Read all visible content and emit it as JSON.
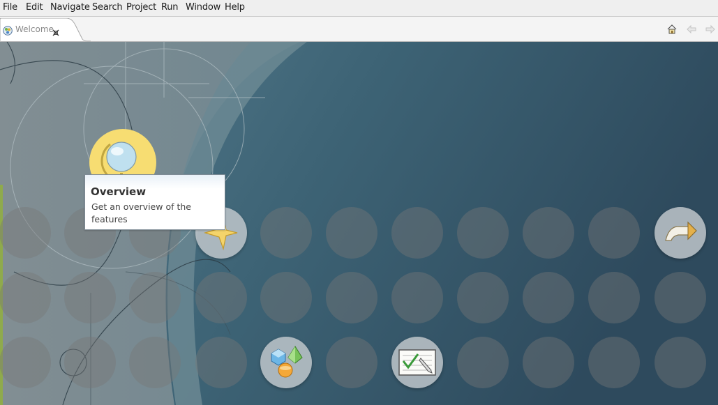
{
  "menu": {
    "items": [
      {
        "label": "File"
      },
      {
        "label": "Edit"
      },
      {
        "label": "Navigate"
      },
      {
        "label": "Search"
      },
      {
        "label": "Project"
      },
      {
        "label": "Run"
      },
      {
        "label": "Window"
      },
      {
        "label": "Help"
      }
    ]
  },
  "tabs": {
    "welcome_label": "Welcome"
  },
  "toolbar": {
    "icons": [
      "home-icon",
      "back-arrow-icon",
      "forward-arrow-icon"
    ]
  },
  "welcome": {
    "tooltip": {
      "title": "Overview",
      "description": "Get an overview of the features"
    },
    "icons": [
      "globe-icon",
      "star-icon",
      "workbench-arrow-icon",
      "samples-shapes-icon",
      "tutorial-checklist-icon"
    ]
  },
  "colors": {
    "accent_yellow": "#f7dd72",
    "canvas_dark": "#2f4c5f",
    "canvas_gray": "#7d8f95"
  }
}
